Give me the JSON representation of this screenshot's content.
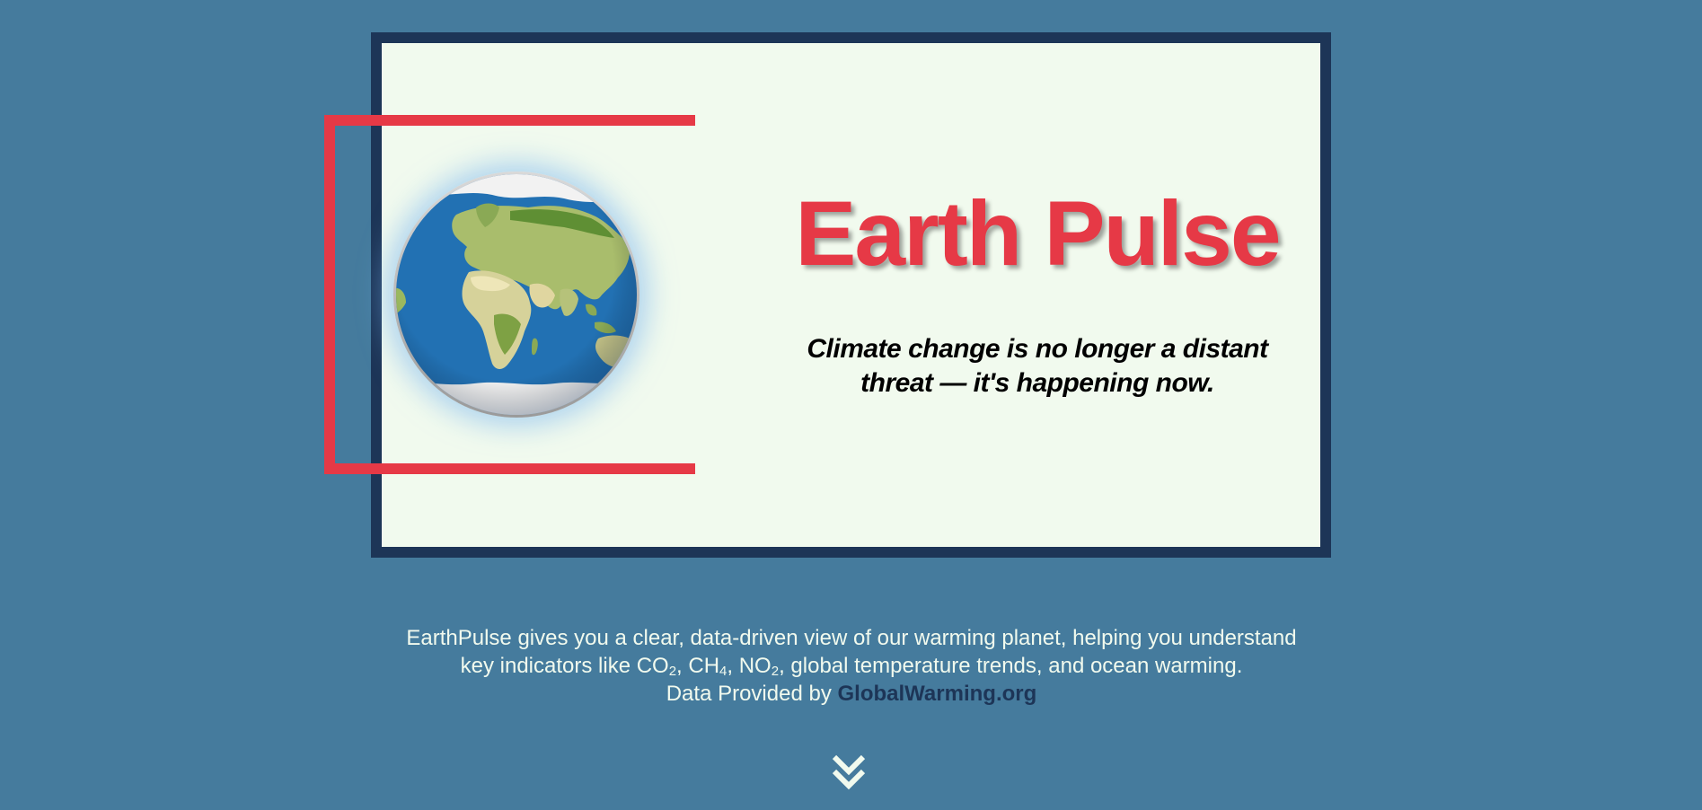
{
  "hero": {
    "title": "Earth Pulse",
    "tagline": "Climate change is no longer a distant threat — it's happening now."
  },
  "intro": {
    "line1": "EarthPulse gives you a clear, data-driven view of our warming planet, helping you understand",
    "line2_prefix": "key indicators like CO",
    "co2_sub": "2",
    "sep1": ", CH",
    "ch4_sub": "4",
    "sep2": ", NO",
    "no2_sub": "2",
    "line2_suffix": ", global temperature trends, and ocean warming.",
    "credit_prefix": "Data Provided by ",
    "credit_link": "GlobalWarming.org"
  },
  "icons": {
    "globe": "earth-globe-icon",
    "scroll": "double-chevron-down-icon"
  },
  "colors": {
    "background": "#457b9d",
    "card_border": "#1d3557",
    "card_fill": "#f1faee",
    "accent_red": "#e63946",
    "link": "#1d3557",
    "text_light": "#f1faee"
  }
}
